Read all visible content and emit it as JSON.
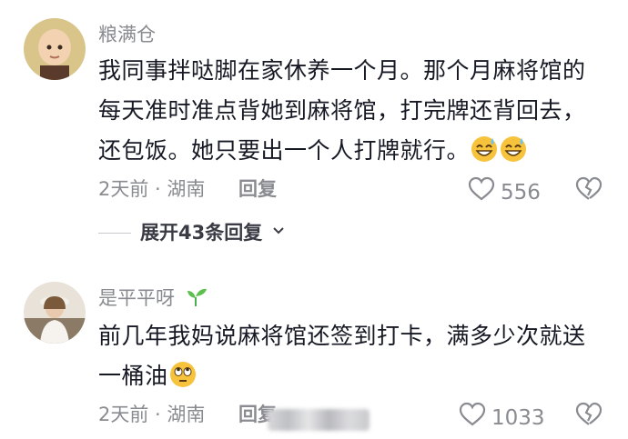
{
  "comments": [
    {
      "username": "粮满仓",
      "lines": [
        "我同事拌哒脚在家休养一个月。那个月麻将馆的",
        "每天准时准点背她到麻将馆，打完牌还背回去，",
        "还包饭。她只要出一个人打牌就行。"
      ],
      "line3_emojis": [
        "grinning-sweat-emoji",
        "grinning-sweat-emoji"
      ],
      "meta": "2天前 · 湖南",
      "reply_label": "回复",
      "likes": "556",
      "expand_label": "展开43条回复"
    },
    {
      "username": "是平平呀",
      "username_badge": "sprout-icon",
      "lines": [
        "前几年我妈说麻将馆还签到打卡，满多少次就送",
        "一桶油"
      ],
      "line2_emoji": "eye-roll-emoji",
      "meta": "2天前 · 湖南",
      "reply_label": "回复",
      "likes": "1033"
    }
  ],
  "colors": {
    "text": "#161823",
    "secondary": "#8a8b91"
  }
}
